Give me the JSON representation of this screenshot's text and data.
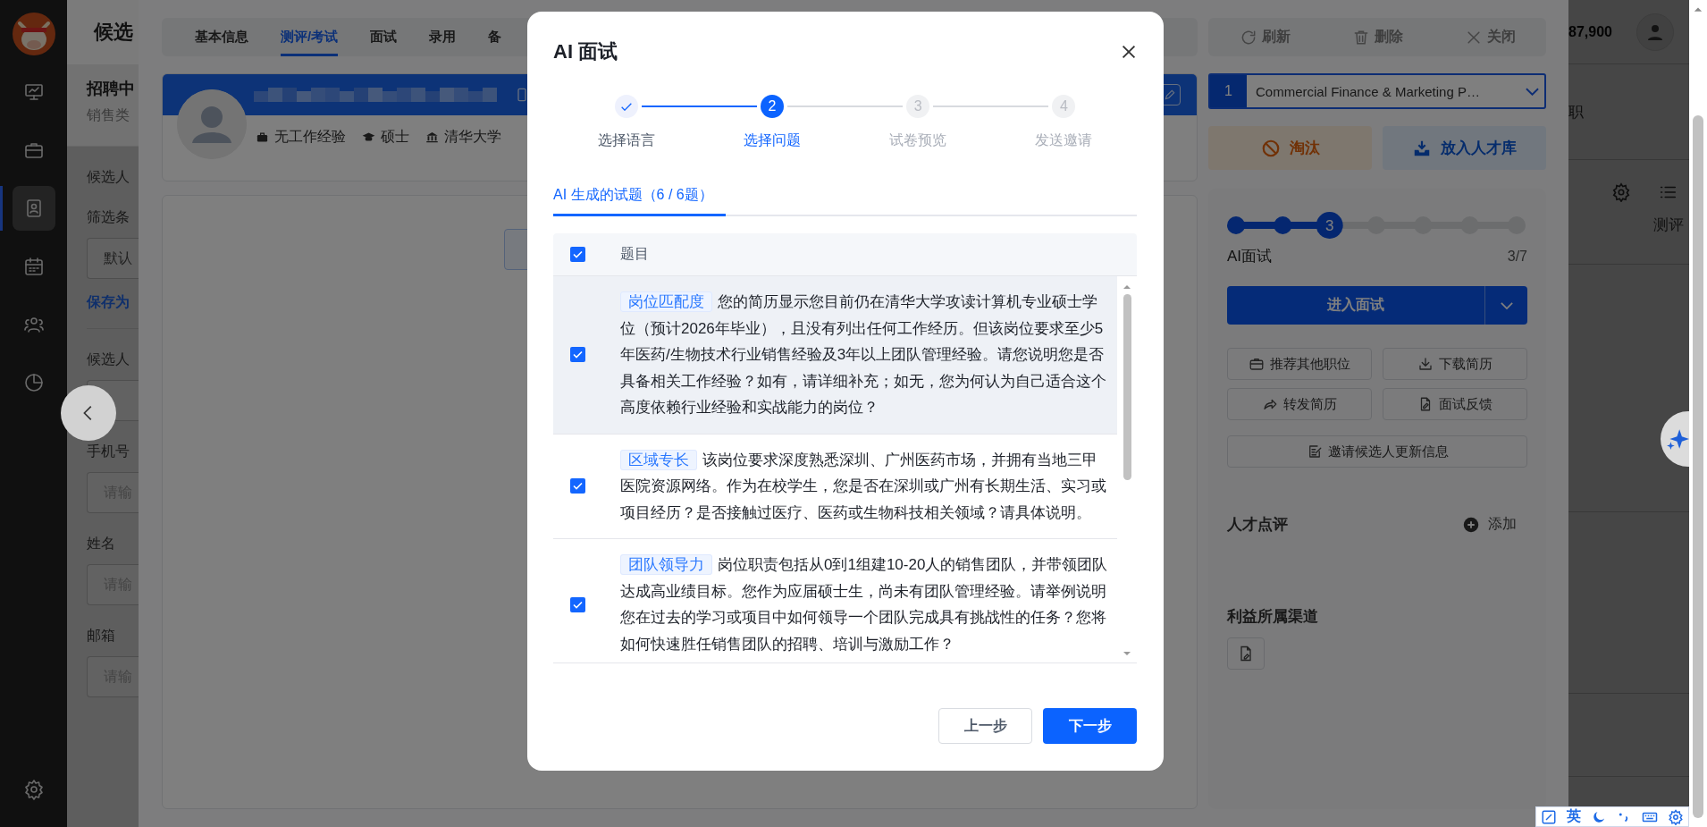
{
  "sidebar": {
    "items": [
      {
        "selected": false
      },
      {
        "selected": false
      },
      {
        "selected": true
      },
      {
        "selected": false
      },
      {
        "selected": false
      },
      {
        "selected": false
      }
    ]
  },
  "candidate_list": {
    "title": "候选",
    "status": "招聘中",
    "category": "销售类",
    "section": "候选人",
    "filter_label": "筛选条",
    "filter_value": "默认",
    "save_link": "保存为",
    "fields": [
      {
        "label": "候选人"
      },
      {
        "label": "手机号",
        "placeholder": "请输"
      },
      {
        "label": "姓名",
        "placeholder": "请输"
      },
      {
        "label": "邮箱",
        "placeholder": "请输"
      }
    ]
  },
  "drawer": {
    "tabs": [
      {
        "label": "基本信息",
        "selected": false
      },
      {
        "label": "测评/考试",
        "selected": true
      },
      {
        "label": "面试",
        "selected": false
      },
      {
        "label": "录用",
        "selected": false
      },
      {
        "label": "备",
        "selected": false
      }
    ],
    "profile": {
      "tags": [
        "无工作经验",
        "硕士",
        "清华大学"
      ]
    },
    "toolbar": [
      "刷新",
      "删除",
      "关闭"
    ],
    "job_select": {
      "index": "1",
      "value": "Commercial Finance & Marketing P…"
    },
    "actions": [
      {
        "label": "淘汰",
        "kind": "danger"
      },
      {
        "label": "放入人才库",
        "kind": "secondary"
      }
    ],
    "progress": {
      "steps": [
        {
          "done": true,
          "current": false
        },
        {
          "done": true,
          "current": false
        },
        {
          "done": false,
          "current": true,
          "number": "3"
        },
        {
          "done": false,
          "current": false
        },
        {
          "done": false,
          "current": false
        },
        {
          "done": false,
          "current": false
        },
        {
          "done": false,
          "current": false
        }
      ],
      "stage": "AI面试",
      "count": "3/7"
    },
    "primary_action": "进入面试",
    "secondary_actions": [
      "推荐其他职位",
      "下载简历",
      "转发简历",
      "面试反馈",
      "邀请候选人更新信息"
    ],
    "review": {
      "title": "人才点评",
      "add": "添加"
    },
    "channel": {
      "title": "利益所属渠道"
    }
  },
  "background_page": {
    "count": "87,900",
    "status_text": "职",
    "tab_text": "测评"
  },
  "modal": {
    "title": "AI 面试",
    "steps": [
      {
        "label": "选择语言",
        "done": true,
        "current": false
      },
      {
        "label": "选择问题",
        "done": false,
        "current": true,
        "number": "2"
      },
      {
        "label": "试卷预览",
        "done": false,
        "current": false,
        "number": "3"
      },
      {
        "label": "发送邀请",
        "done": false,
        "current": false,
        "number": "4"
      }
    ],
    "tab": {
      "label": "AI 生成的试题（6 / 6题）",
      "selected": true
    },
    "table": {
      "header": "题目",
      "all_checked": true,
      "rows": [
        {
          "checked": true,
          "hovered": true,
          "tag": "岗位匹配度",
          "text": "您的简历显示您目前仍在清华大学攻读计算机专业硕士学位（预计2026年毕业），且没有列出任何工作经历。但该岗位要求至少5年医药/生物技术行业销售经验及3年以上团队管理经验。请您说明您是否具备相关工作经验？如有，请详细补充；如无，您为何认为自己适合这个高度依赖行业经验和实战能力的岗位？"
        },
        {
          "checked": true,
          "hovered": false,
          "tag": "区域专长",
          "text": "该岗位要求深度熟悉深圳、广州医药市场，并拥有当地三甲医院资源网络。作为在校学生，您是否在深圳或广州有长期生活、实习或项目经历？是否接触过医疗、医药或生物科技相关领域？请具体说明。"
        },
        {
          "checked": true,
          "hovered": false,
          "tag": "团队领导力",
          "text": "岗位职责包括从0到1组建10-20人的销售团队，并带领团队达成高业绩目标。您作为应届硕士生，尚未有团队管理经验。请举例说明您在过去的学习或项目中如何领导一个团队完成具有挑战性的任务？您将如何快速胜任销售团队的招聘、培训与激励工作？"
        }
      ]
    },
    "buttons": [
      {
        "label": "上一步",
        "kind": "default"
      },
      {
        "label": "下一步",
        "kind": "primary"
      }
    ]
  },
  "ime": {
    "mode": "英"
  }
}
